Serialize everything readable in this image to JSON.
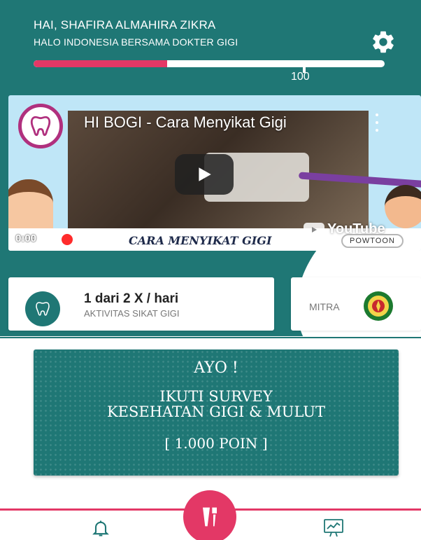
{
  "header": {
    "greeting": "HAI, SHAFIRA ALMAHIRA ZIKRA",
    "subtitle": "HALO INDONESIA BERSAMA DOKTER GIGI",
    "progress": {
      "value_fraction": 0.38,
      "target_label": "100"
    },
    "colors": {
      "primary": "#1f7775",
      "accent": "#e33866"
    },
    "icons": {
      "settings": "gear-icon"
    }
  },
  "video": {
    "title": "HI BOGI - Cara Menyikat Gigi",
    "caption": "CARA MENYIKAT GIGI",
    "time": "0:00",
    "youtube_label": "YouTube",
    "powtoon_label": "POWTOON",
    "icons": {
      "play": "play-icon",
      "menu": "more-vertical-icon"
    }
  },
  "activity": {
    "count": "1 dari 2 X / hari",
    "label": "AKTIVITAS SIKAT GIGI",
    "icon": "tooth-icon"
  },
  "mitra": {
    "label": "MITRA",
    "icon": "partner-logo"
  },
  "survey": {
    "line1": "AYO !",
    "line2": "IKUTI SURVEY",
    "line3": "KESEHATAN GIGI & MULUT",
    "line4": "[ 1.000 POIN ]"
  },
  "nav": {
    "icons": {
      "left": "bell-icon",
      "center": "toothbrush-icon",
      "right": "chart-icon"
    }
  }
}
